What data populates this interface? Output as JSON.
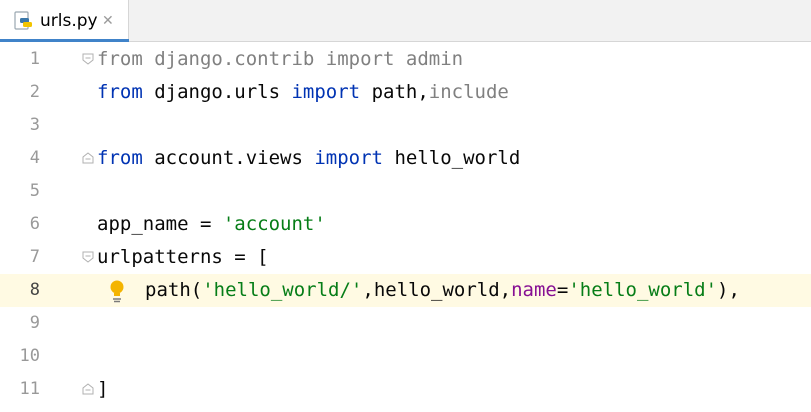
{
  "tab": {
    "label": "urls.py",
    "close_glyph": "✕",
    "icon": "python-file-icon"
  },
  "lines": [
    {
      "num": "1"
    },
    {
      "num": "2"
    },
    {
      "num": "3"
    },
    {
      "num": "4"
    },
    {
      "num": "5"
    },
    {
      "num": "6"
    },
    {
      "num": "7"
    },
    {
      "num": "8"
    },
    {
      "num": "9"
    },
    {
      "num": "10"
    },
    {
      "num": "11"
    }
  ],
  "code": {
    "l1": {
      "from": "from",
      "mod": " django.contrib ",
      "import": "import",
      "name": " admin"
    },
    "l2": {
      "from": "from",
      "mod": " django.urls ",
      "import": "import",
      "name": " path",
      "comma": ",",
      "name2": "include"
    },
    "l4": {
      "from": "from",
      "mod": " account.views ",
      "import": "import",
      "name": " hello_world"
    },
    "l6": {
      "var": "app_name = ",
      "val": "'account'"
    },
    "l7": {
      "text": "urlpatterns = ["
    },
    "l8": {
      "fn": "path(",
      "arg1": "'hello_world/'",
      "comma1": ",",
      "arg2": "hello_world",
      "comma2": ",",
      "kw": "name",
      "eq": "=",
      "arg3": "'hello_world'",
      "end": "),"
    },
    "l11": {
      "text": "]"
    }
  },
  "colors": {
    "keyword": "#0033b3",
    "string": "#067d17",
    "kwarg": "#871094",
    "unused": "#808080",
    "current_line": "#fffae3"
  }
}
